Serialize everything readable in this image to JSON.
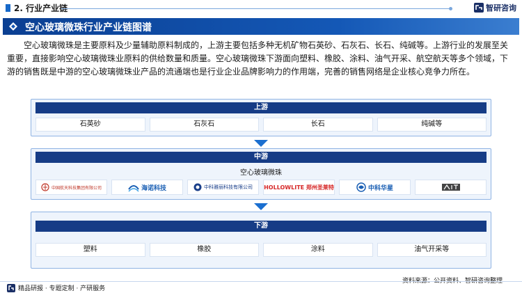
{
  "section": {
    "title": "2. 行业产业链"
  },
  "brand": {
    "name": "智研咨询"
  },
  "title": "空心玻璃微珠行业产业链图谱",
  "description": "空心玻璃微珠是主要原料及少量辅助原料制成的，上游主要包括多种无机矿物石英砂、石灰石、长石、纯碱等。上游行业的发展至关重要，直接影响空心玻璃微珠业原料的供给数量和质量。空心玻璃微珠下游面向塑料、橡胶、涂料、油气开采、航空航天等多个领域，下游的销售既是中游的空心玻璃微珠业产品的流通端也是行业企业品牌影响力的作用端，完善的销售网络是企业核心竞争力所在。",
  "upstream": {
    "label": "上游",
    "items": [
      "石英砂",
      "石灰石",
      "长石",
      "纯碱等"
    ]
  },
  "midstream": {
    "label": "中游",
    "product": "空心玻璃微珠",
    "companies": [
      {
        "name": "中国航天科技集团有限公司",
        "icon": "aerospace-logo-icon",
        "color": "#c0392b"
      },
      {
        "name": "海诺科技",
        "sub": "HAINUO TECHNOLOGY",
        "icon": "hainuo-logo-icon",
        "color": "#1a5fb4"
      },
      {
        "name": "中科雅丽科技有限公司",
        "sub": "ZHONGKE YALI TECHNOLOGY CO.,LTD",
        "icon": "yali-logo-icon",
        "color": "#1a3f8a"
      },
      {
        "name": "HOLLOWLITE 郑州圣莱特",
        "icon": "hollowlite-logo-icon",
        "color": "#d62828"
      },
      {
        "name": "中科华星",
        "sub": "ZHONGKE HUAXING",
        "icon": "huaxing-logo-icon",
        "color": "#1a5fb4"
      },
      {
        "name": "",
        "icon": "brand-mark-icon",
        "color": "#333333"
      }
    ]
  },
  "downstream": {
    "label": "下游",
    "items": [
      "塑料",
      "橡胶",
      "涂料",
      "油气开采等"
    ]
  },
  "footer": {
    "left": "精品研报 · 专题定制 · 产研服务",
    "source": "资料来源：公开资料、智研咨询整理"
  }
}
